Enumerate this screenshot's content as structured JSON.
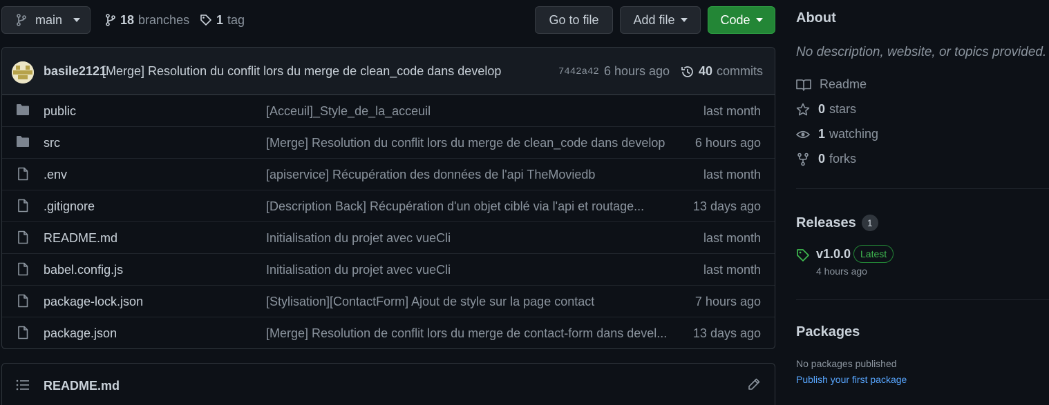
{
  "toolbar": {
    "branch": "main",
    "branches_count": "18",
    "branches_label": "branches",
    "tags_count": "1",
    "tags_label": "tag",
    "go_to_file": "Go to file",
    "add_file": "Add file",
    "code": "Code"
  },
  "commit": {
    "author": "basile2121",
    "message": "[Merge] Resolution du conflit lors du merge de clean_code dans develop",
    "sha": "7442a42",
    "time": "6 hours ago",
    "commits_count": "40",
    "commits_label": "commits"
  },
  "files": [
    {
      "name": "public",
      "type": "folder",
      "commit": "[Acceuil]_Style_de_la_acceuil",
      "date": "last month"
    },
    {
      "name": "src",
      "type": "folder",
      "commit": "[Merge] Resolution du conflit lors du merge de clean_code dans develop",
      "date": "6 hours ago"
    },
    {
      "name": ".env",
      "type": "file",
      "commit": "[apiservice] Récupération des données de l'api TheMoviedb",
      "date": "last month"
    },
    {
      "name": ".gitignore",
      "type": "file",
      "commit": "[Description Back] Récupération d'un objet ciblé via l'api et routage...",
      "date": "13 days ago"
    },
    {
      "name": "README.md",
      "type": "file",
      "commit": "Initialisation du projet avec vueCli",
      "date": "last month"
    },
    {
      "name": "babel.config.js",
      "type": "file",
      "commit": "Initialisation du projet avec vueCli",
      "date": "last month"
    },
    {
      "name": "package-lock.json",
      "type": "file",
      "commit": "[Stylisation][ContactForm] Ajout de style sur la page contact",
      "date": "7 hours ago"
    },
    {
      "name": "package.json",
      "type": "file",
      "commit": "[Merge] Resolution de conflit lors du merge de contact-form dans devel...",
      "date": "13 days ago"
    }
  ],
  "readme": {
    "title": "README.md"
  },
  "sidebar": {
    "about_title": "About",
    "about_desc": "No description, website, or topics provided.",
    "readme_label": "Readme",
    "stars_count": "0",
    "stars_label": "stars",
    "watching_count": "1",
    "watching_label": "watching",
    "forks_count": "0",
    "forks_label": "forks",
    "releases_title": "Releases",
    "releases_count": "1",
    "release_name": "v1.0.0",
    "release_badge": "Latest",
    "release_time": "4 hours ago",
    "packages_title": "Packages",
    "packages_none": "No packages published",
    "packages_link": "Publish your first package"
  },
  "colors": {
    "background": "#0d1117",
    "accent_green": "#238636",
    "link_blue": "#58a6ff",
    "muted": "#8b949e"
  }
}
